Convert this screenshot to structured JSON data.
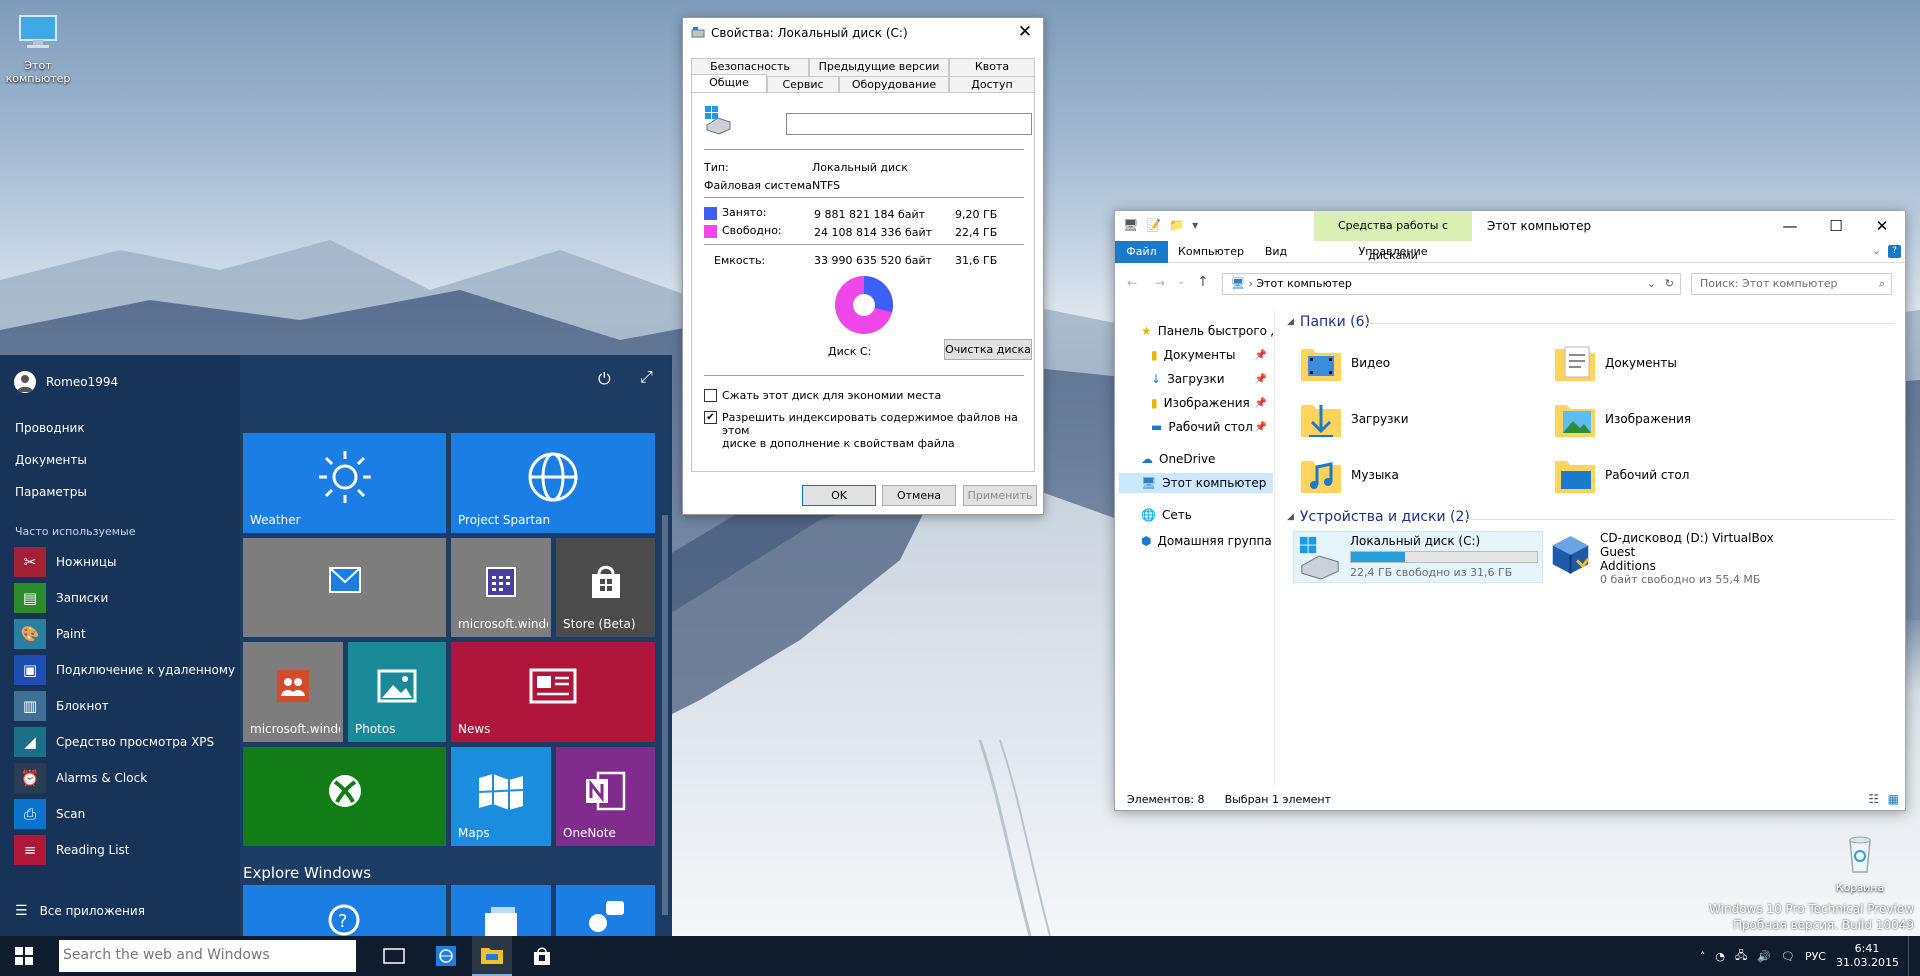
{
  "desktop": {
    "this_pc_label": "Этот компьютер",
    "recycle_label": "Корзина",
    "watermark_line1": "Windows 10 Pro Technical Preview",
    "watermark_line2": "Пробная версия. Build 10049"
  },
  "start": {
    "user": "Romeo1994",
    "links": [
      "Проводник",
      "Документы",
      "Параметры"
    ],
    "frequent_title": "Часто используемые",
    "apps": [
      {
        "label": "Ножницы",
        "color": "#a32036",
        "icon": "scissors-icon"
      },
      {
        "label": "Записки",
        "color": "#2c8c2c",
        "icon": "sticky-notes-icon"
      },
      {
        "label": "Paint",
        "color": "#2a7f9e",
        "icon": "paint-icon"
      },
      {
        "label": "Подключение к удаленному ра",
        "color": "#1e4db0",
        "icon": "remote-desktop-icon"
      },
      {
        "label": "Блокнот",
        "color": "#3f6f94",
        "icon": "notepad-icon"
      },
      {
        "label": "Средство просмотра XPS",
        "color": "#1b6f88",
        "icon": "xps-viewer-icon"
      },
      {
        "label": "Alarms & Clock",
        "color": "#2b3d55",
        "icon": "alarm-icon"
      },
      {
        "label": "Scan",
        "color": "#0a73cc",
        "icon": "scan-icon"
      },
      {
        "label": "Reading List",
        "color": "#b0173a",
        "icon": "reading-list-icon"
      }
    ],
    "all_apps": "Все приложения",
    "explore": "Explore Windows",
    "tiles": {
      "weather": "Weather",
      "spartan": "Project Spartan",
      "mail": "",
      "calendar": "microsoft.windo",
      "store": "Store (Beta)",
      "people": "microsoft.windo",
      "photos": "Photos",
      "news": "News",
      "xbox": "",
      "maps": "Maps",
      "onenote": "OneNote"
    },
    "colors": {
      "blue": "#1a7ee4",
      "gray": "#7d7d7d",
      "teal": "#1a8a98",
      "red": "#b0153b",
      "green": "#127d17",
      "maps": "#1a8ddf",
      "onenote": "#7f2c8d",
      "store": "#4b4b4b"
    }
  },
  "taskbar": {
    "search_placeholder": "Search the web and Windows",
    "language": "РУС",
    "time": "6:41",
    "date": "31.03.2015"
  },
  "props": {
    "title": "Свойства: Локальный диск (C:)",
    "tabs_top": [
      "Безопасность",
      "Предыдущие версии",
      "Квота"
    ],
    "tabs_bottom": [
      "Общие",
      "Сервис",
      "Оборудование",
      "Доступ"
    ],
    "name_value": "",
    "type_label": "Тип:",
    "type_value": "Локальный диск",
    "fs_label": "Файловая система:",
    "fs_value": "NTFS",
    "used_label": "Занято:",
    "used_bytes": "9 881 821 184 байт",
    "used_gb": "9,20 ГБ",
    "free_label": "Свободно:",
    "free_bytes": "24 108 814 336 байт",
    "free_gb": "22,4 ГБ",
    "cap_label": "Емкость:",
    "cap_bytes": "33 990 635 520 байт",
    "cap_gb": "31,6 ГБ",
    "drive_label": "Диск C:",
    "cleanup": "Очистка диска",
    "compress": "Сжать этот диск для экономии места",
    "index_line1": "Разрешить индексировать содержимое файлов на этом",
    "index_line2": "диске в дополнение к свойствам файла",
    "ok": "OK",
    "cancel": "Отмена",
    "apply": "Применить",
    "used_color": "#3d5ff5",
    "free_color": "#f048e8",
    "used_fraction": 0.291
  },
  "explorer": {
    "title": "Этот компьютер",
    "context_tab": "Средства работы с дисками",
    "ribbon_tabs": [
      "Файл",
      "Компьютер",
      "Вид",
      "Управление"
    ],
    "address": "Этот компьютер",
    "search_placeholder": "Поиск: Этот компьютер",
    "nav": [
      "Панель быстрого д",
      "Документы",
      "Загрузки",
      "Изображения",
      "Рабочий стол",
      "OneDrive",
      "Этот компьютер",
      "Сеть",
      "Домашняя группа"
    ],
    "folders_title": "Папки (6)",
    "folders": [
      "Видео",
      "Документы",
      "Загрузки",
      "Изображения",
      "Музыка",
      "Рабочий стол"
    ],
    "devices_title": "Устройства и диски (2)",
    "drive_c": {
      "name": "Локальный диск (C:)",
      "space": "22,4 ГБ свободно из 31,6 ГБ",
      "used_fraction": 0.291
    },
    "drive_d": {
      "name1": "CD-дисковод (D:) VirtualBox Guest",
      "name2": "Additions",
      "space": "0 байт свободно из 55,4 МБ"
    },
    "status_count": "Элементов: 8",
    "status_sel": "Выбран 1 элемент"
  }
}
